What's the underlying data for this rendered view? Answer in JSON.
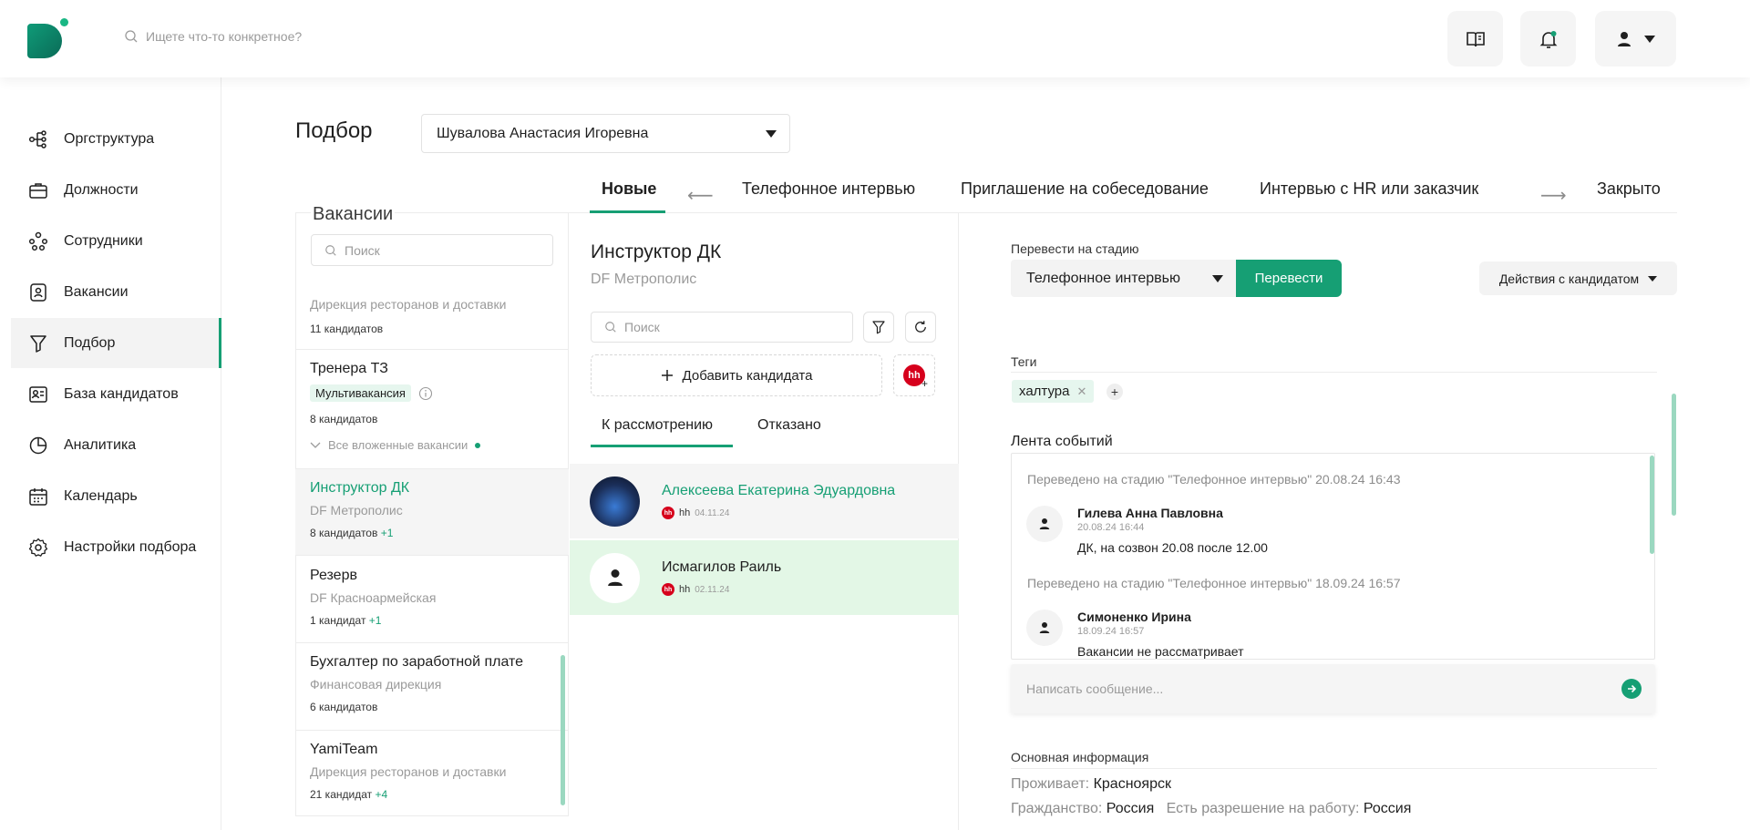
{
  "header": {
    "search_placeholder": "Ищете что-то конкретное?"
  },
  "sidebar": {
    "items": [
      {
        "label": "Оргструктура"
      },
      {
        "label": "Должности"
      },
      {
        "label": "Сотрудники"
      },
      {
        "label": "Вакансии"
      },
      {
        "label": "Подбор"
      },
      {
        "label": "База кандидатов"
      },
      {
        "label": "Аналитика"
      },
      {
        "label": "Календарь"
      },
      {
        "label": "Настройки подбора"
      }
    ],
    "active": "Подбор"
  },
  "page": {
    "title": "Подбор",
    "recruiter": "Шувалова Анастасия Игоревна"
  },
  "stages": [
    "Новые",
    "Телефонное интервью",
    "Приглашение на собеседование",
    "Интервью с HR или заказчик",
    "Закрыто"
  ],
  "vacancies": {
    "title": "Вакансии",
    "search_placeholder": "Поиск",
    "items": [
      {
        "dept": "Дирекция ресторанов и доставки",
        "count": "11 кандидатов"
      },
      {
        "title": "Тренера ТЗ",
        "badge": "Мультивакансия",
        "count": "8 кандидатов",
        "nested": "Все вложенные вакансии"
      },
      {
        "title": "Инструктор ДК",
        "dept": "DF Метрополис",
        "count": "8 кандидатов",
        "extra": "+1"
      },
      {
        "title": "Резерв",
        "dept": "DF Красноармейская",
        "count": "1 кандидат",
        "extra": "+1"
      },
      {
        "title": "Бухгалтер по заработной плате",
        "dept": "Финансовая дирекция",
        "count": "6 кандидатов"
      },
      {
        "title": "YamiTeam",
        "dept": "Дирекция ресторанов и доставки",
        "count": "21 кандидат",
        "extra": "+4"
      }
    ]
  },
  "candidates": {
    "vacancy_title": "Инструктор ДК",
    "vacancy_org": "DF Метрополис",
    "search_placeholder": "Поиск",
    "add_label": "Добавить кандидата",
    "hh_label": "hh",
    "tabs": [
      "К рассмотрению",
      "Отказано"
    ],
    "list": [
      {
        "name": "Алексеева Екатерина Эдуардовна",
        "source": "hh",
        "date": "04.11.24"
      },
      {
        "name": "Исмагилов Раиль",
        "source": "hh",
        "date": "02.11.24"
      }
    ]
  },
  "details": {
    "move_label": "Перевести на стадию",
    "move_select": "Телефонное интервью",
    "move_button": "Перевести",
    "actions_button": "Действия с кандидатом",
    "tags_label": "Теги",
    "tags": [
      "халтура"
    ],
    "feed_label": "Лента событий",
    "feed": [
      {
        "event": "Переведено на стадию \"Телефонное интервью\" 20.08.24 16:43",
        "author": "Гилева Анна Павловна",
        "date": "20.08.24 16:44",
        "text": "ДК, на созвон 20.08 после 12.00"
      },
      {
        "event": "Переведено на стадию \"Телефонное интервью\" 18.09.24 16:57",
        "author": "Симоненко Ирина",
        "date": "18.09.24 16:57",
        "text": "Вакансии не рассматривает"
      }
    ],
    "message_placeholder": "Написать сообщение...",
    "info_label": "Основная информация",
    "lives_label": "Проживает:",
    "lives_value": "Красноярск",
    "citizenship_label": "Гражданство:",
    "citizenship_value": "Россия",
    "permit_label": "Есть разрешение на работу:",
    "permit_value": "Россия"
  },
  "colors": {
    "accent": "#169f74",
    "accent_light": "#e6f6ee",
    "hh": "#d6001c"
  }
}
